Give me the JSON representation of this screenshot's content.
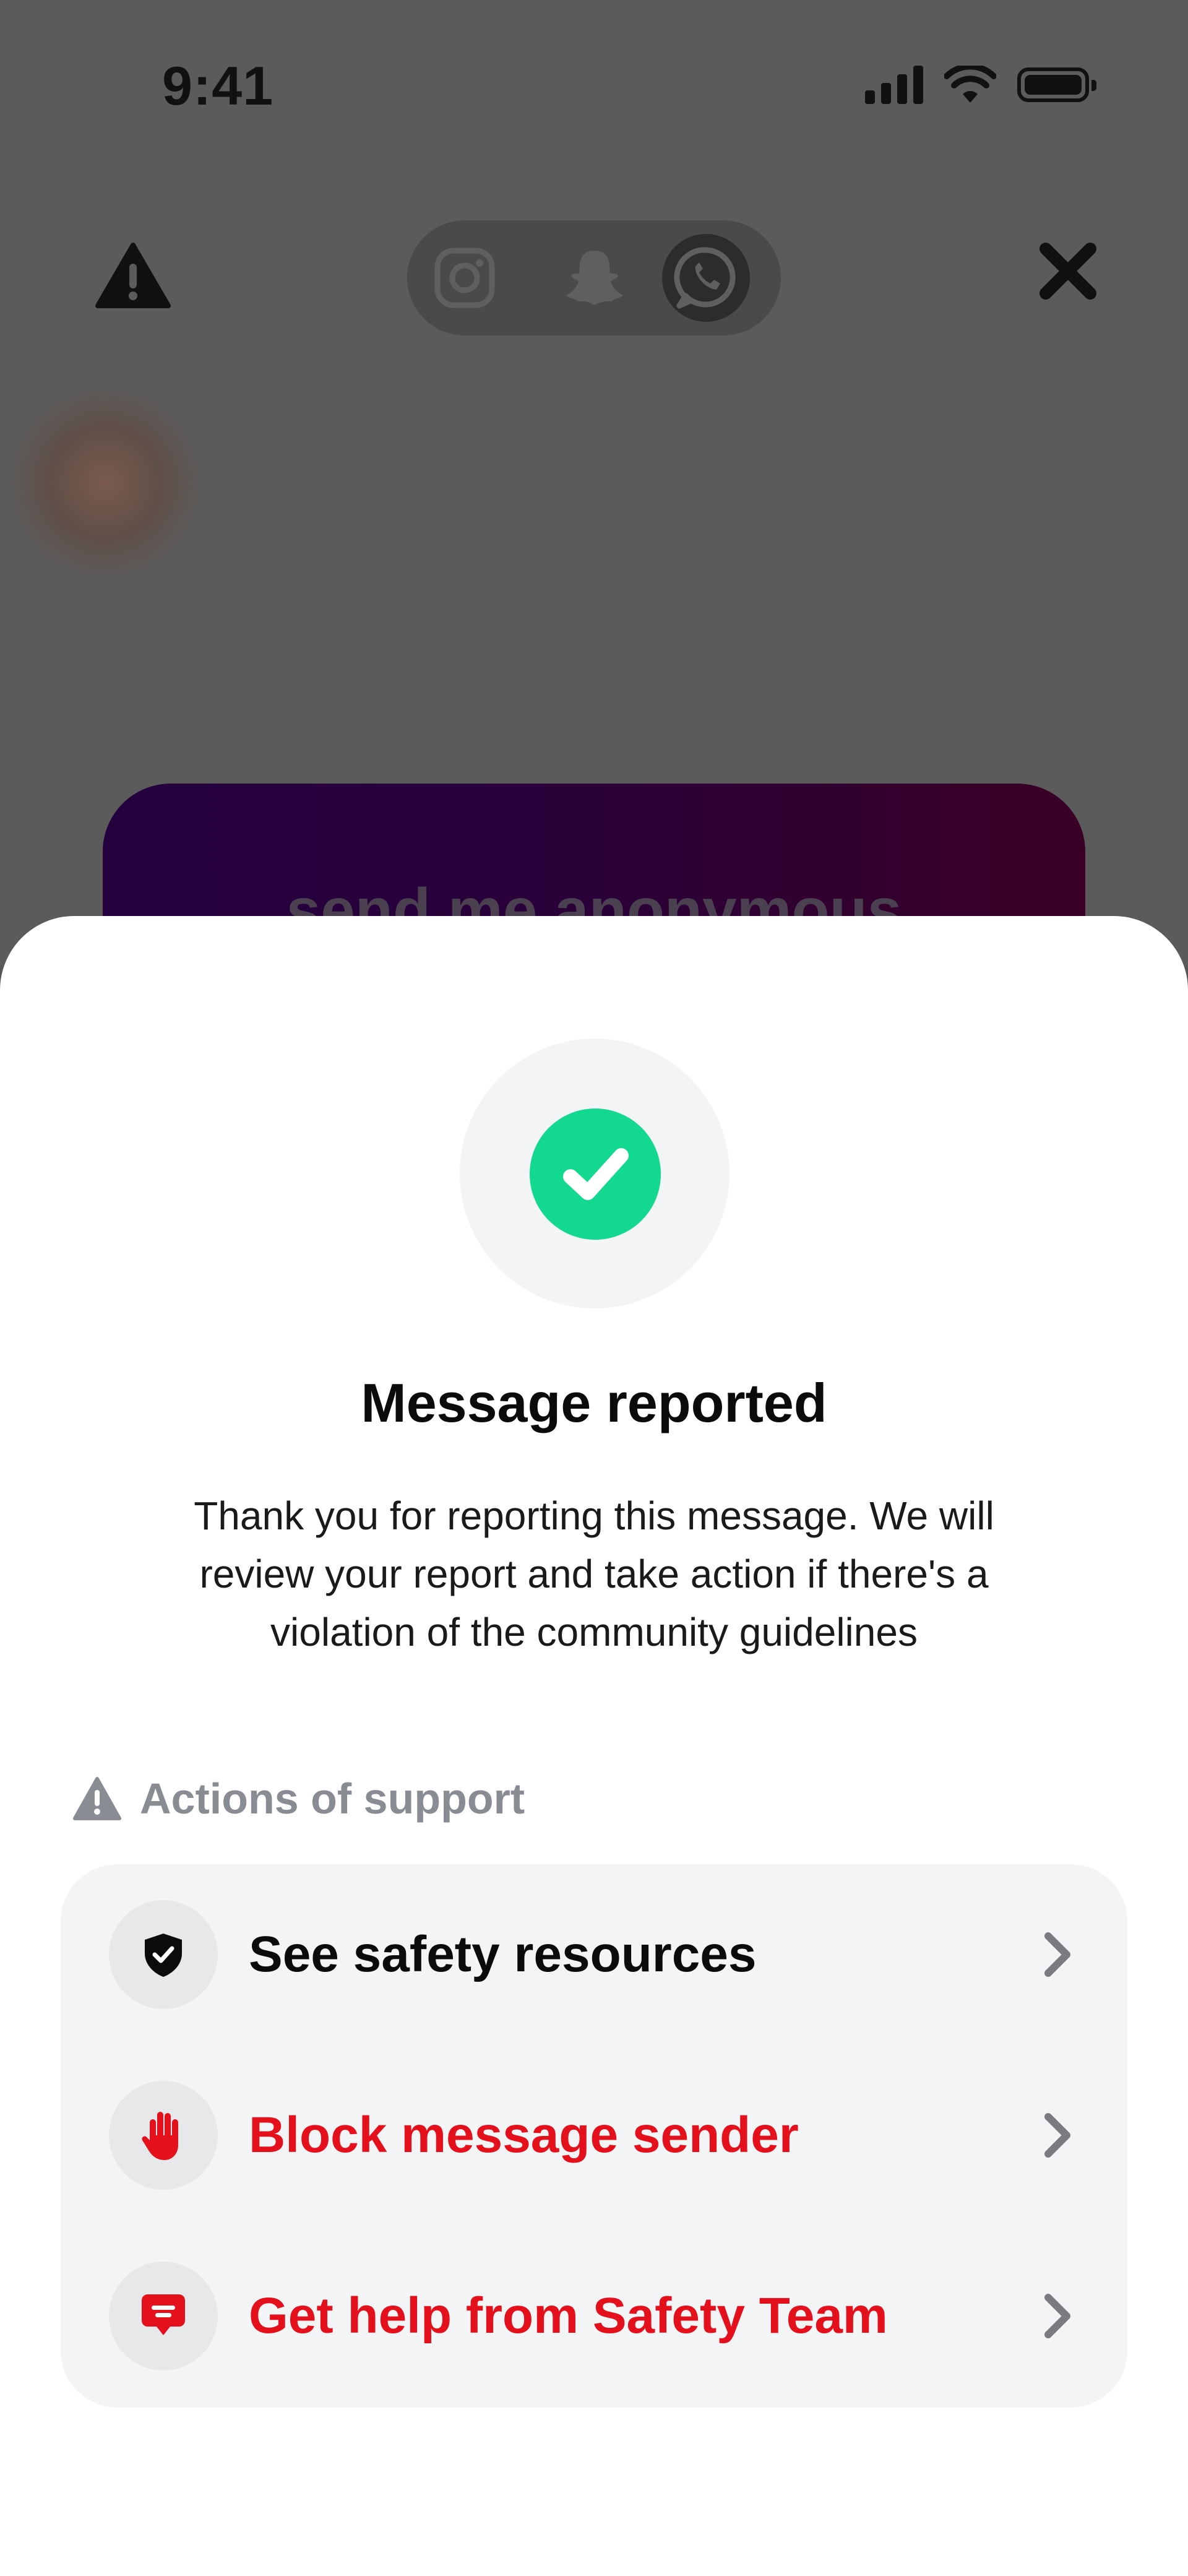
{
  "status_bar": {
    "time": "9:41"
  },
  "background": {
    "share_icons": [
      "instagram-icon",
      "snapchat-icon",
      "whatsapp-icon"
    ],
    "selected_share": "whatsapp-icon",
    "promo_text": "send me anonymous"
  },
  "sheet": {
    "title": "Message reported",
    "description_lines": [
      "Thank you for reporting this message. We will",
      "review your report and take action if there's a",
      "violation of the community guidelines"
    ],
    "section_label": "Actions of support",
    "actions": [
      {
        "label": "See safety resources",
        "icon": "shield-check-icon",
        "color": "#0b0b0b"
      },
      {
        "label": "Block message sender",
        "icon": "hand-stop-icon",
        "color": "#e4101c"
      },
      {
        "label": "Get help from Safety Team",
        "icon": "chat-bubble-icon",
        "color": "#e4101c"
      }
    ]
  },
  "colors": {
    "success": "#12d98f",
    "danger": "#e4101c",
    "muted": "#8a8c93"
  }
}
